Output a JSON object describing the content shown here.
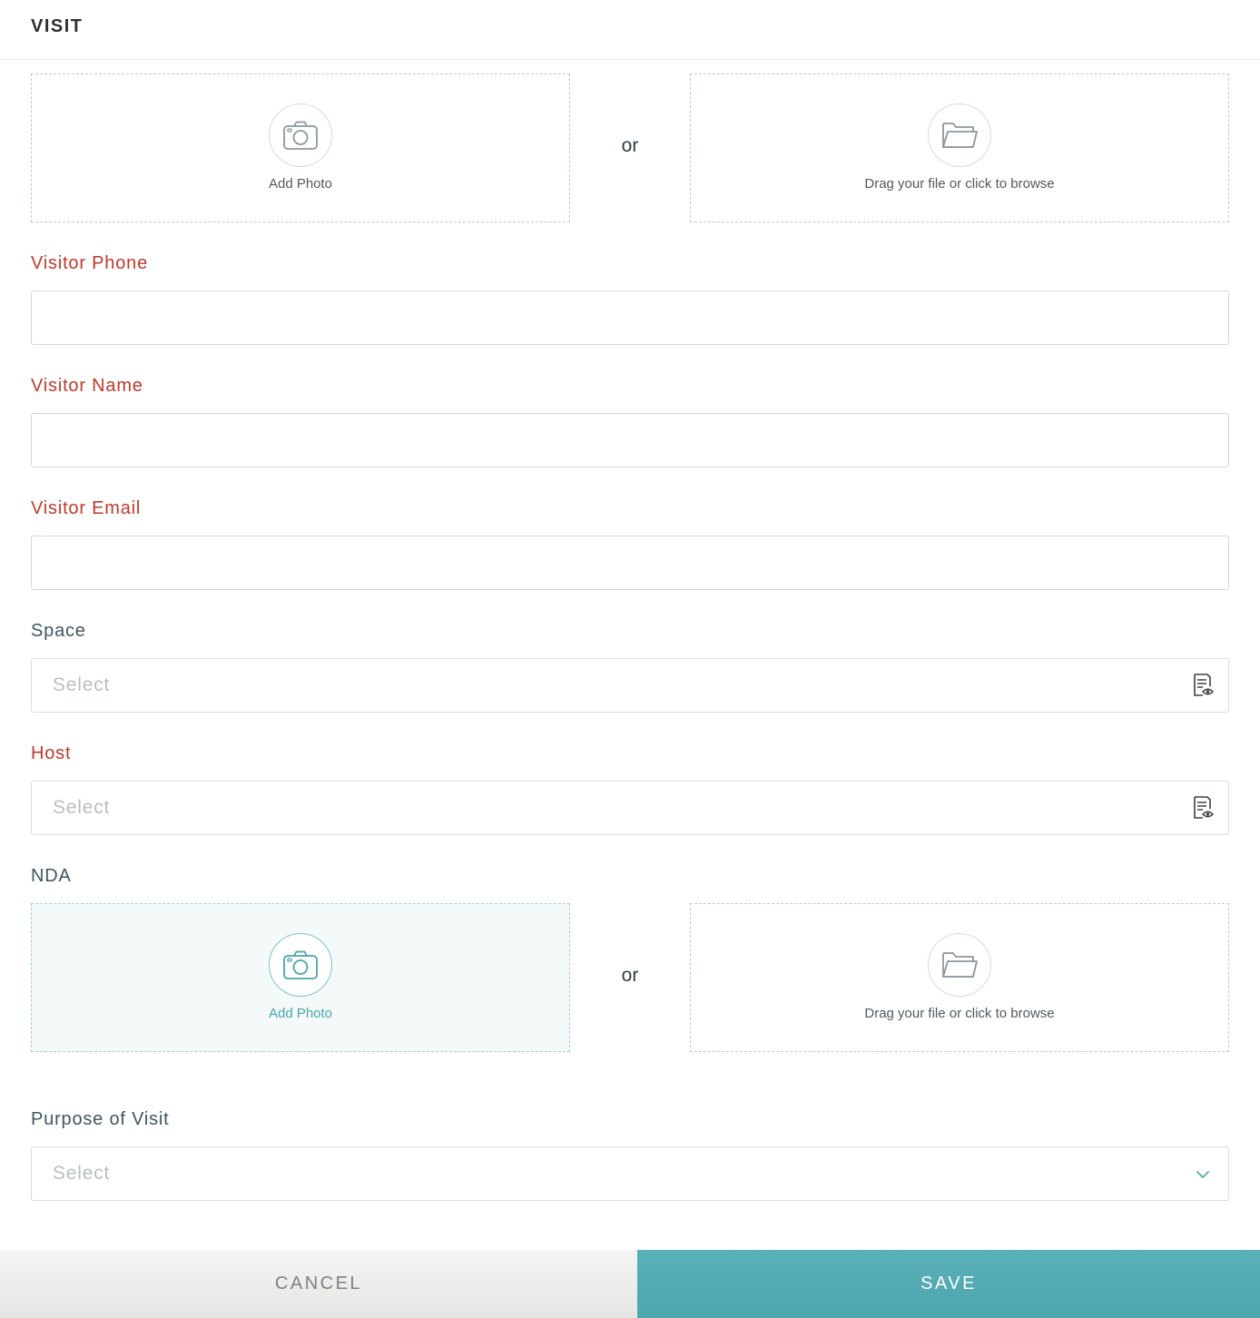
{
  "header": {
    "title": "VISIT"
  },
  "photo_upload": {
    "add_photo_label": "Add Photo",
    "or_text": "or",
    "browse_label": "Drag your file or click to browse"
  },
  "fields": {
    "visitor_phone": {
      "label": "Visitor Phone",
      "value": ""
    },
    "visitor_name": {
      "label": "Visitor Name",
      "value": ""
    },
    "visitor_email": {
      "label": "Visitor Email",
      "value": ""
    },
    "space": {
      "label": "Space",
      "placeholder": "Select"
    },
    "host": {
      "label": "Host",
      "placeholder": "Select"
    },
    "nda": {
      "label": "NDA",
      "add_photo_label": "Add Photo",
      "or_text": "or",
      "browse_label": "Drag your file or click to browse"
    },
    "purpose_of_visit": {
      "label": "Purpose of Visit",
      "placeholder": "Select"
    }
  },
  "footer": {
    "cancel_label": "CANCEL",
    "save_label": "SAVE"
  },
  "colors": {
    "required_label": "#c0392b",
    "label": "#3e5663",
    "accent": "#56abb4",
    "cancel_bg": "#eeefed"
  },
  "icons": {
    "camera": "camera-icon",
    "folder": "folder-icon",
    "lookup": "list-view-icon",
    "dropdown": "chevron-down-icon"
  }
}
